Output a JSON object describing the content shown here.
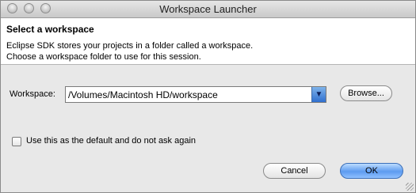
{
  "window": {
    "title": "Workspace Launcher"
  },
  "header": {
    "title": "Select a workspace",
    "description_line1": "Eclipse SDK stores your projects in a folder called a workspace.",
    "description_line2": "Choose a workspace folder to use for this session."
  },
  "workspace": {
    "label": "Workspace:",
    "value": "/Volumes/Macintosh HD/workspace",
    "browse_label": "Browse..."
  },
  "default_option": {
    "label": "Use this as the default and do not ask again",
    "checked": false
  },
  "buttons": {
    "cancel": "Cancel",
    "ok": "OK"
  },
  "colors": {
    "accent": "#5d9bf0",
    "header_bg": "#ffffff",
    "dialog_bg": "#e8e8e8"
  }
}
